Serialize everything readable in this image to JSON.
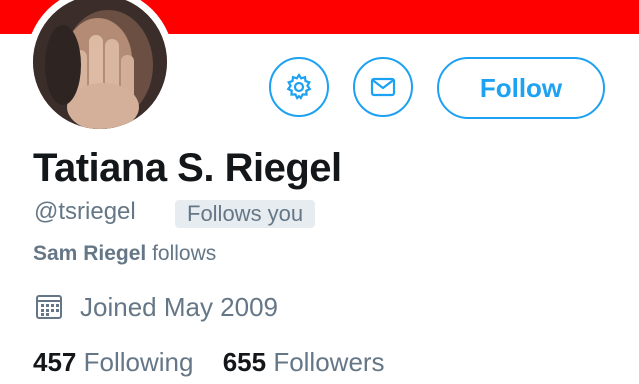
{
  "colors": {
    "banner": "#ff0000",
    "accent": "#1da1f2",
    "text_primary": "#14171a",
    "text_secondary": "#657786"
  },
  "profile": {
    "name": "Tatiana S. Riegel",
    "handle": "@tsriegel",
    "follows_you_badge": "Follows you",
    "mutual_follower_name": "Sam Riegel",
    "mutual_follows_text": "follows",
    "joined_text": "Joined May 2009"
  },
  "actions": {
    "settings_icon": "gear-icon",
    "message_icon": "envelope-icon",
    "follow_label": "Follow"
  },
  "stats": {
    "following_count": "457",
    "following_label": "Following",
    "followers_count": "655",
    "followers_label": "Followers"
  },
  "icons": {
    "joined": "calendar-icon"
  }
}
